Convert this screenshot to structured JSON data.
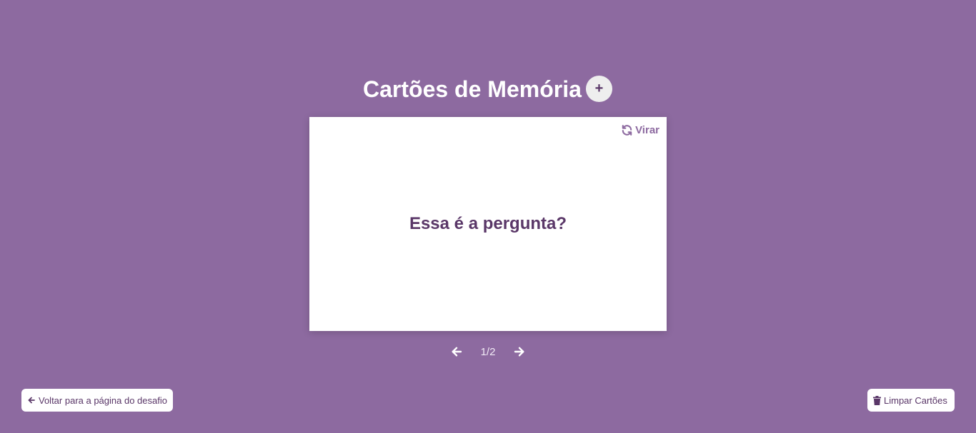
{
  "header": {
    "title": "Cartões de Memória",
    "add_label": "+"
  },
  "card": {
    "flip_label": "Virar",
    "question": "Essa é a pergunta?"
  },
  "navigation": {
    "counter": "1/2"
  },
  "footer": {
    "back_label": "Voltar para a página do desafio",
    "clear_label": "Limpar Cartões"
  },
  "colors": {
    "background": "#8d6aa0",
    "card": "#ffffff",
    "text_dark": "#5a3768",
    "accent": "#8d6aa0"
  },
  "icons": {
    "flip": "refresh-icon",
    "prev": "arrow-left-icon",
    "next": "arrow-right-icon",
    "back": "arrow-left-icon",
    "clear": "trash-icon"
  }
}
